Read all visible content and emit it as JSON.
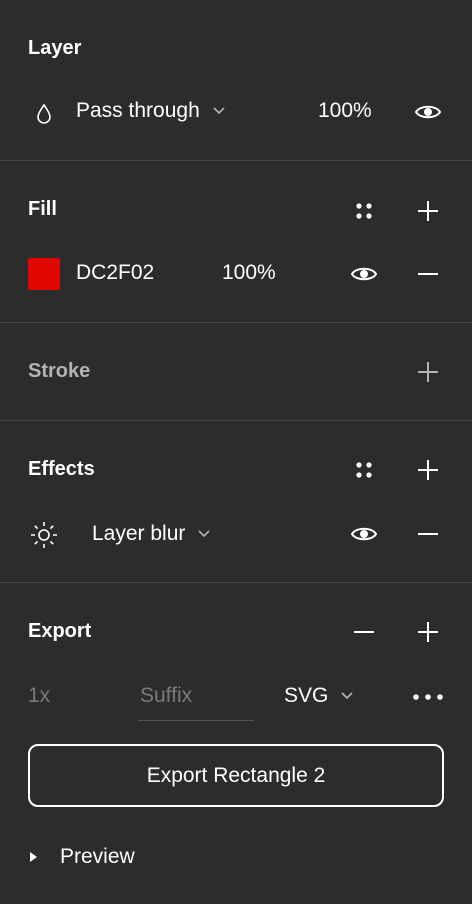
{
  "layer": {
    "title": "Layer",
    "blend_mode": "Pass through",
    "opacity": "100%"
  },
  "fill": {
    "title": "Fill",
    "hex": "DC2F02",
    "color": "#DC2F02",
    "opacity": "100%"
  },
  "stroke": {
    "title": "Stroke"
  },
  "effects": {
    "title": "Effects",
    "effect_type": "Layer blur"
  },
  "export": {
    "title": "Export",
    "scale": "1x",
    "suffix_placeholder": "Suffix",
    "format": "SVG",
    "button_label": "Export Rectangle 2",
    "preview_label": "Preview"
  },
  "icons": {
    "blend": "droplet-icon",
    "eye": "eye-icon",
    "plus": "plus-icon",
    "minus": "minus-icon",
    "styles": "four-dots-icon",
    "blur": "sun-icon",
    "chevron": "chevron-down-icon",
    "more": "more-horizontal-icon",
    "caret": "caret-right-icon"
  }
}
